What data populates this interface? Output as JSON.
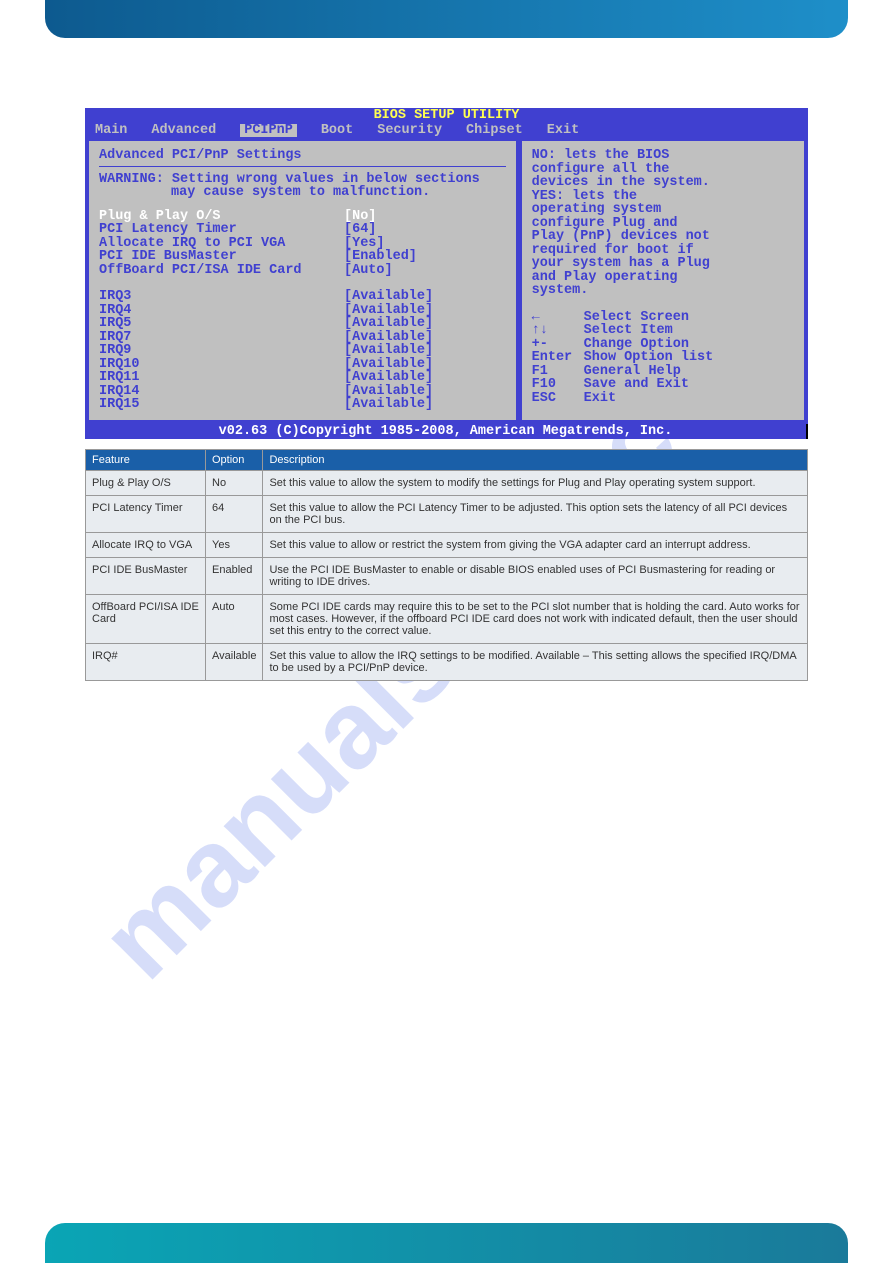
{
  "watermark": "manualshive.com",
  "bios": {
    "title": "BIOS SETUP UTILITY",
    "menu": [
      "Main",
      "Advanced",
      "PCIPnP",
      "Boot",
      "Security",
      "Chipset",
      "Exit"
    ],
    "active_menu_index": 2,
    "left": {
      "section_title": "Advanced PCI/PnP Settings",
      "warning_label": "WARNING:",
      "warning_line1": "Setting wrong values in below sections",
      "warning_line2": "may cause system to malfunction.",
      "highlight": {
        "label": "Plug & Play O/S",
        "value": "[No]"
      },
      "rows": [
        {
          "label": "PCI Latency Timer",
          "value": "[64]"
        },
        {
          "label": "Allocate IRQ to PCI VGA",
          "value": "[Yes]"
        },
        {
          "label": "PCI IDE BusMaster",
          "value": "[Enabled]"
        },
        {
          "label": "OffBoard PCI/ISA IDE Card",
          "value": "[Auto]"
        }
      ],
      "irq_rows": [
        {
          "label": "IRQ3",
          "value": "[Available]"
        },
        {
          "label": "IRQ4",
          "value": "[Available]"
        },
        {
          "label": "IRQ5",
          "value": "[Available]"
        },
        {
          "label": "IRQ7",
          "value": "[Available]"
        },
        {
          "label": "IRQ9",
          "value": "[Available]"
        },
        {
          "label": "IRQ10",
          "value": "[Available]"
        },
        {
          "label": "IRQ11",
          "value": "[Available]"
        },
        {
          "label": "IRQ14",
          "value": "[Available]"
        },
        {
          "label": "IRQ15",
          "value": "[Available]"
        }
      ]
    },
    "right": {
      "help_text_lines": [
        "NO: lets the BIOS",
        "configure all the",
        "devices in the system.",
        "YES: lets the",
        "operating system",
        "configure Plug and",
        "Play (PnP) devices not",
        "required for boot if",
        "your system has a Plug",
        "and Play operating",
        "system."
      ],
      "nav": [
        {
          "key": "←",
          "desc": "Select Screen"
        },
        {
          "key": "↑↓",
          "desc": "Select Item"
        },
        {
          "key": "+-",
          "desc": "Change Option"
        },
        {
          "key": "Enter",
          "desc": "Show Option list"
        },
        {
          "key": "F1",
          "desc": "General Help"
        },
        {
          "key": "F10",
          "desc": "Save and Exit"
        },
        {
          "key": "ESC",
          "desc": "Exit"
        }
      ]
    },
    "footer": "v02.63 (C)Copyright 1985-2008, American Megatrends, Inc."
  },
  "table": {
    "headers": [
      "Feature",
      "Option",
      "Description"
    ],
    "rows": [
      {
        "feature": "Plug & Play O/S",
        "option": "No",
        "desc": "Set this value to allow the system to modify the settings for Plug and Play operating system support."
      },
      {
        "feature": "PCI Latency Timer",
        "option": "64",
        "desc": "Set this value to allow the PCI Latency Timer to be adjusted. This option sets the latency of all PCI devices on the PCI bus."
      },
      {
        "feature": "Allocate IRQ to VGA",
        "option": "Yes",
        "desc": "Set this value to allow or restrict the system from giving the VGA adapter card an interrupt address."
      },
      {
        "feature": "PCI IDE BusMaster",
        "option": "Enabled",
        "desc": "Use the PCI IDE BusMaster to enable or disable BIOS enabled uses of PCI Busmastering for reading or writing to IDE drives."
      },
      {
        "feature": "OffBoard PCI/ISA IDE Card",
        "option": "Auto",
        "desc": "Some PCI IDE cards may require this to be set to the PCI slot number that is holding the card. Auto works for most cases. However, if the offboard PCI IDE card does not work with indicated default, then the user should set this entry to the correct value."
      },
      {
        "feature": "IRQ#",
        "option": "Available",
        "desc": "Set this value to allow the IRQ settings to be modified. Available – This setting allows the specified IRQ/DMA to be used by a PCI/PnP device."
      }
    ]
  }
}
